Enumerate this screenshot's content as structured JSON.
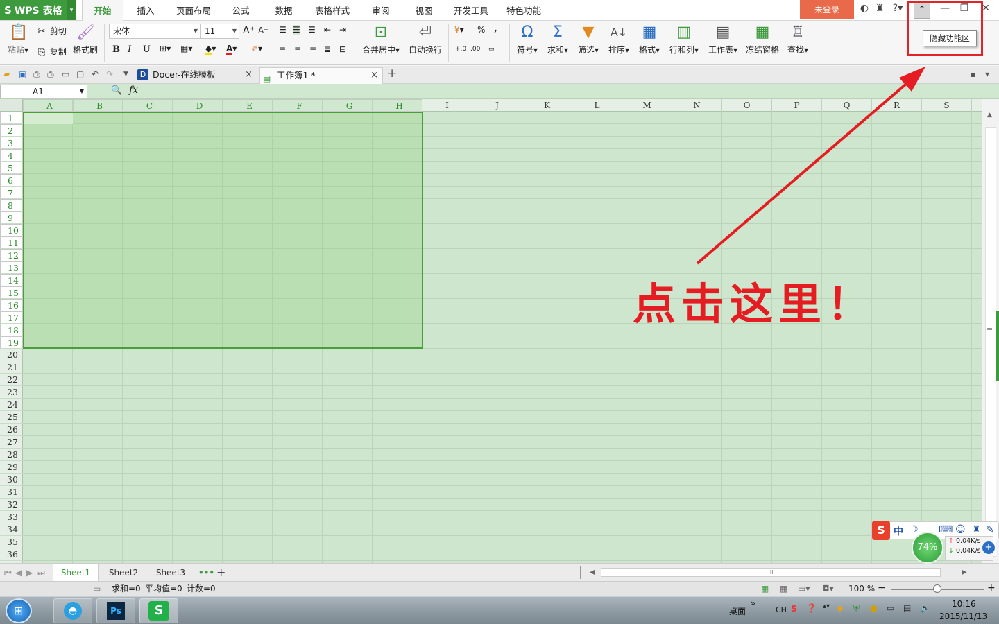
{
  "app": {
    "name": "WPS 表格",
    "logo_glyph": "S"
  },
  "menu": {
    "tabs": [
      "开始",
      "插入",
      "页面布局",
      "公式",
      "数据",
      "表格样式",
      "审阅",
      "视图",
      "开发工具",
      "特色功能"
    ],
    "active": "开始",
    "login": "未登录",
    "tooltip": "隐藏功能区"
  },
  "ribbon": {
    "paste": "粘贴",
    "cut": "剪切",
    "copy": "复制",
    "format_painter": "格式刷",
    "font_name": "宋体",
    "font_size": "11",
    "bold": "B",
    "italic": "I",
    "underline": "U",
    "font_color_glyph": "A",
    "grow_font": "A⁺",
    "shrink_font": "A⁻",
    "merge_center": "合并居中",
    "wrap_text": "自动换行",
    "percent": "%",
    "comma": ",",
    "symbol": "符号",
    "sum": "求和",
    "filter": "筛选",
    "sort": "排序",
    "format": "格式",
    "row_col": "行和列",
    "worksheet": "工作表",
    "freeze": "冻结窗格",
    "find": "查找"
  },
  "tabs": {
    "docs": [
      {
        "label": "Docer-在线模板"
      },
      {
        "label": "工作簿1 *"
      }
    ],
    "add": "+"
  },
  "formula": {
    "name_box": "A1",
    "fx": "fx",
    "search_glyph": "🔍"
  },
  "grid": {
    "columns": [
      "A",
      "B",
      "C",
      "D",
      "E",
      "F",
      "G",
      "H",
      "I",
      "J",
      "K",
      "L",
      "M",
      "N",
      "O",
      "P",
      "Q",
      "R",
      "S"
    ],
    "rows": [
      "1",
      "2",
      "3",
      "4",
      "5",
      "6",
      "7",
      "8",
      "9",
      "10",
      "11",
      "12",
      "13",
      "14",
      "15",
      "16",
      "17",
      "18",
      "19",
      "20",
      "21",
      "22",
      "23",
      "24",
      "25",
      "26",
      "27",
      "28",
      "29",
      "30",
      "31",
      "32",
      "33",
      "34",
      "35",
      "36"
    ],
    "selected_cols": [
      "A",
      "B",
      "C",
      "D",
      "E",
      "F",
      "G",
      "H"
    ],
    "selected_rows_count": 19
  },
  "sheets": {
    "names": [
      "Sheet1",
      "Sheet2",
      "Sheet3"
    ],
    "active": "Sheet1",
    "more": "•••",
    "add": "+",
    "scroll_mark": "III"
  },
  "status": {
    "sum": "求和=0",
    "avg": "平均值=0",
    "count": "计数=0",
    "zoom": "100 %"
  },
  "annotation": {
    "text": "点击这里！",
    "color": "#e51d23"
  },
  "ime": {
    "mode": "中",
    "badge": "S"
  },
  "network": {
    "percent": "74%",
    "up": "0.04K/s",
    "down": "0.04K/s"
  },
  "taskbar": {
    "desktop": "桌面",
    "lang": "CH",
    "time": "10:16",
    "date": "2015/11/13",
    "ps_label": "Ps",
    "wps_label": "S",
    "chevron": "»"
  },
  "colors": {
    "brand": "#3d9a3d",
    "login": "#e86a4a",
    "grid_bg": "#cde6cd",
    "selection_border": "#4a9e3a",
    "annotation": "#e51d23"
  }
}
